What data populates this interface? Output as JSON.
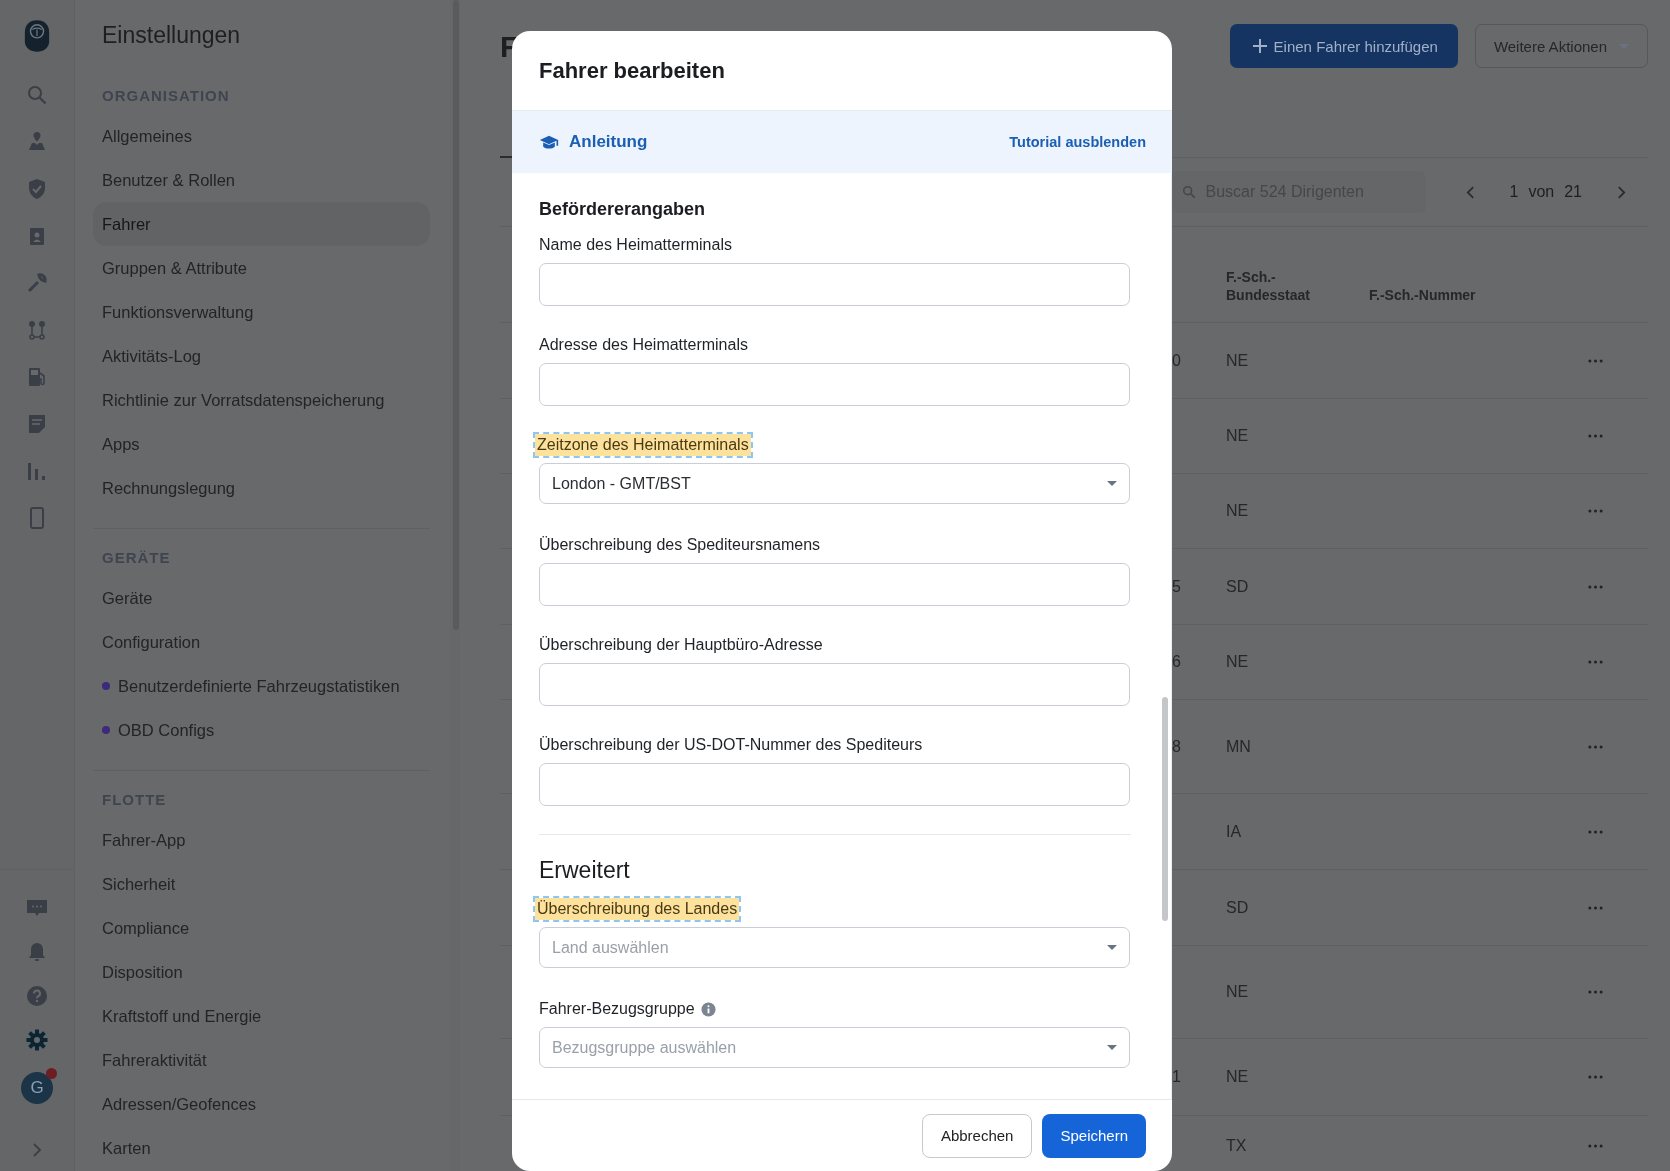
{
  "nav_rail": {
    "top": [
      {
        "kind": "search",
        "selected": false
      },
      {
        "kind": "map",
        "selected": false
      },
      {
        "kind": "shield",
        "selected": false
      },
      {
        "kind": "badge",
        "selected": false
      },
      {
        "kind": "wrench",
        "selected": false
      },
      {
        "kind": "route",
        "selected": false
      },
      {
        "kind": "fuel",
        "selected": false
      },
      {
        "kind": "document",
        "selected": false
      },
      {
        "kind": "chart",
        "selected": false
      },
      {
        "kind": "phone",
        "selected": false
      }
    ],
    "bottom": [
      {
        "kind": "chat",
        "selected": false
      },
      {
        "kind": "bell",
        "selected": false
      },
      {
        "kind": "help",
        "selected": false
      },
      {
        "kind": "gear",
        "selected": true
      }
    ],
    "avatar": {
      "initial": "G",
      "notification": true
    }
  },
  "sidebar": {
    "title": "Einstellungen",
    "sections": [
      {
        "heading": "ORGANISATION",
        "items": [
          {
            "label": "Allgemeines",
            "selected": false
          },
          {
            "label": "Benutzer & Rollen",
            "selected": false
          },
          {
            "label": "Fahrer",
            "selected": true
          },
          {
            "label": "Gruppen & Attribute",
            "selected": false
          },
          {
            "label": "Funktionsverwaltung",
            "selected": false
          },
          {
            "label": "Aktivitäts-Log",
            "selected": false
          },
          {
            "label": "Richtlinie zur Vorratsdatenspeicherung",
            "selected": false
          },
          {
            "label": "Apps",
            "selected": false
          },
          {
            "label": "Rechnungslegung",
            "selected": false
          }
        ]
      },
      {
        "heading": "GERÄTE",
        "items": [
          {
            "label": "Geräte",
            "selected": false,
            "dot": false
          },
          {
            "label": "Configuration",
            "selected": false,
            "dot": false
          },
          {
            "label": "Benutzerdefinierte Fahrzeugstatistiken",
            "selected": false,
            "dot": true
          },
          {
            "label": "OBD Configs",
            "selected": false,
            "dot": true
          }
        ]
      },
      {
        "heading": "FLOTTE",
        "items": [
          {
            "label": "Fahrer-App",
            "selected": false
          },
          {
            "label": "Sicherheit",
            "selected": false
          },
          {
            "label": "Compliance",
            "selected": false
          },
          {
            "label": "Disposition",
            "selected": false
          },
          {
            "label": "Kraftstoff und Energie",
            "selected": false
          },
          {
            "label": "Fahreraktivität",
            "selected": false
          },
          {
            "label": "Adressen/Geofences",
            "selected": false
          },
          {
            "label": "Karten",
            "selected": false
          }
        ]
      }
    ]
  },
  "page": {
    "title": "F",
    "add_button": "Einen Fahrer hinzufügen",
    "more_button": "Weitere Aktionen",
    "search": {
      "placeholder": "Buscar 524 Dirigenten"
    },
    "pager": {
      "current": "1",
      "of": "von",
      "total": "21"
    },
    "table": {
      "columns": [
        "",
        "F.-Sch.-Bundesstaat",
        "F.-Sch.-Nummer"
      ],
      "rows": [
        {
          "column_1": "0",
          "state": "NE"
        },
        {
          "column_1": "",
          "state": "NE"
        },
        {
          "column_1": "",
          "state": "NE"
        },
        {
          "column_1": "5",
          "state": "SD"
        },
        {
          "column_1": "6",
          "state": "NE"
        },
        {
          "column_1": "8",
          "state": "MN"
        },
        {
          "column_1": "",
          "state": "IA"
        },
        {
          "column_1": "",
          "state": "SD"
        },
        {
          "column_1": "",
          "state": "NE"
        },
        {
          "column_1": "1",
          "state": "NE"
        },
        {
          "column_1": "",
          "state": "TX"
        }
      ]
    }
  },
  "modal": {
    "title": "Fahrer bearbeiten",
    "tutorial": {
      "label": "Anleitung",
      "hide_link": "Tutorial ausblenden"
    },
    "sections": [
      {
        "title": "Befördererangaben",
        "kind": "plain",
        "fields": [
          {
            "label": "Name des Heimatterminals",
            "kind": "text",
            "highlighted": false,
            "info": false
          },
          {
            "label": "Adresse des Heimatterminals",
            "kind": "text",
            "highlighted": false,
            "info": false
          },
          {
            "label": "Zeitzone des Heimatterminals",
            "kind": "select",
            "highlighted": true,
            "info": false,
            "value": "London - GMT/BST"
          },
          {
            "label": "Überschreibung des Spediteursnamens",
            "kind": "text",
            "highlighted": false,
            "info": false
          },
          {
            "label": "Überschreibung der Hauptbüro-Adresse",
            "kind": "text",
            "highlighted": false,
            "info": false
          },
          {
            "label": "Überschreibung der US-DOT-Nummer des Spediteurs",
            "kind": "text",
            "highlighted": false,
            "info": false
          }
        ]
      },
      {
        "title": "Erweitert",
        "kind": "large",
        "fields": [
          {
            "label": "Überschreibung des Landes",
            "kind": "select",
            "highlighted": true,
            "info": false,
            "placeholder": "Land auswählen"
          },
          {
            "label": "Fahrer-Bezugsgruppe",
            "kind": "select",
            "highlighted": false,
            "info": true,
            "placeholder": "Bezugsgruppe auswählen"
          }
        ]
      }
    ],
    "buttons": {
      "cancel": "Abbrechen",
      "save": "Speichern"
    }
  }
}
